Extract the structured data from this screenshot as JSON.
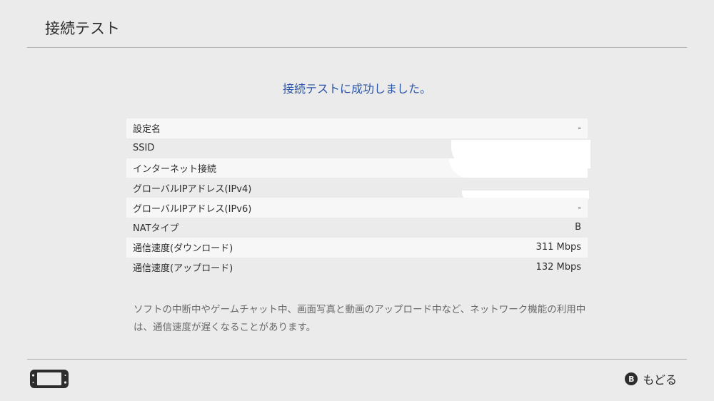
{
  "header": {
    "title": "接続テスト"
  },
  "result": {
    "message": "接続テストに成功しました。"
  },
  "info_rows": [
    {
      "label": "設定名",
      "value": "-"
    },
    {
      "label": "SSID",
      "value": ""
    },
    {
      "label": "インターネット接続",
      "value": ""
    },
    {
      "label": "グローバルIPアドレス(IPv4)",
      "value": ""
    },
    {
      "label": "グローバルIPアドレス(IPv6)",
      "value": "-"
    },
    {
      "label": "NATタイプ",
      "value": "B"
    },
    {
      "label": "通信速度(ダウンロード)",
      "value": "311 Mbps"
    },
    {
      "label": "通信速度(アップロード)",
      "value": "132 Mbps"
    }
  ],
  "note": "ソフトの中断中やゲームチャット中、画面写真と動画のアップロード中など、ネットワーク機能の利用中は、通信速度が遅くなることがあります。",
  "footer": {
    "console_icon": "handheld-console-icon",
    "back_button_glyph": "B",
    "back_label": "もどる"
  },
  "colors": {
    "background": "#ebebeb",
    "row_light": "#f7f7f7",
    "accent_blue": "#2b55a6",
    "text": "#2d2d2d",
    "note_text": "#6a6a6a"
  }
}
